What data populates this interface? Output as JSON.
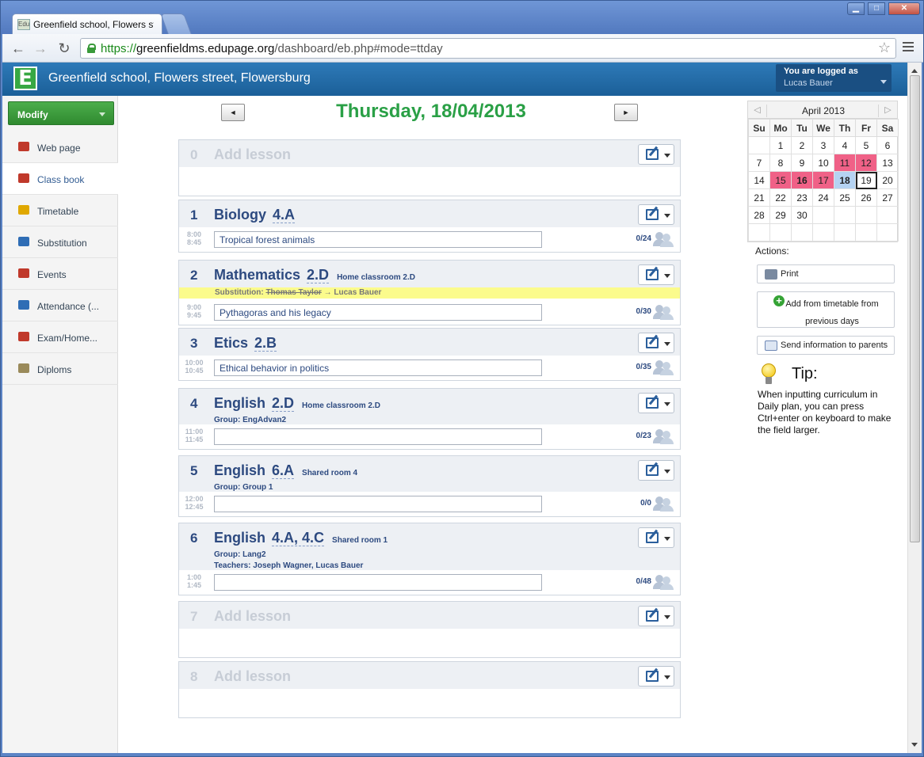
{
  "browser": {
    "tab_title": "Greenfield school, Flowers st",
    "tab_favicon": "Edu",
    "url_scheme": "https://",
    "url_host": "greenfieldms.edupage.org",
    "url_path": "/dashboard/eb.php#mode=ttday",
    "window_buttons": {
      "minimize": "▁",
      "maximize": "□",
      "close": "✕"
    }
  },
  "header": {
    "logo_letter": "E",
    "school_name": "Greenfield school, Flowers street, Flowersburg",
    "logged_label": "You are logged as",
    "user_name": "Lucas Bauer"
  },
  "sidebar": {
    "modify_label": "Modify",
    "items": [
      {
        "label": "Web page",
        "icon": "house-icon",
        "color": "#c0392b"
      },
      {
        "label": "Class book",
        "icon": "book-icon",
        "color": "#c0392b"
      },
      {
        "label": "Timetable",
        "icon": "bell-icon",
        "color": "#e0a800"
      },
      {
        "label": "Substitution",
        "icon": "people-icon",
        "color": "#2f6db5"
      },
      {
        "label": "Events",
        "icon": "calendar-icon",
        "color": "#c0392b"
      },
      {
        "label": "Attendance (...",
        "icon": "pencil-icon",
        "color": "#2f6db5"
      },
      {
        "label": "Exam/Home...",
        "icon": "books-icon",
        "color": "#c0392b"
      },
      {
        "label": "Diploms",
        "icon": "diploma-icon",
        "color": "#9a8a5a"
      }
    ]
  },
  "main": {
    "prev_label": "◄",
    "next_label": "►",
    "date_title": "Thursday, 18/04/2013",
    "lessons": [
      {
        "num": "0",
        "subject": "Add lesson",
        "empty": true
      },
      {
        "num": "1",
        "subject": "Biology",
        "class": "4.A",
        "time_start": "8:00",
        "time_end": "8:45",
        "topic": "Tropical forest animals",
        "attendance": "0/24"
      },
      {
        "num": "2",
        "subject": "Mathematics",
        "class": "2.D",
        "room": "Home classroom 2.D",
        "substitution_label": "Substitution:",
        "substitution_from": "Thomas Taylor",
        "substitution_to": "→ Lucas Bauer",
        "time_start": "9:00",
        "time_end": "9:45",
        "topic": "Pythagoras and his legacy",
        "attendance": "0/30"
      },
      {
        "num": "3",
        "subject": "Etics",
        "class": "2.B",
        "time_start": "10:00",
        "time_end": "10:45",
        "topic": "Ethical behavior in politics",
        "attendance": "0/35"
      },
      {
        "num": "4",
        "subject": "English",
        "class": "2.D",
        "room": "Home classroom 2.D",
        "group": "Group: EngAdvan2",
        "time_start": "11:00",
        "time_end": "11:45",
        "topic": "",
        "attendance": "0/23"
      },
      {
        "num": "5",
        "subject": "English",
        "class": "6.A",
        "room": "Shared room 4",
        "group": "Group: Group 1",
        "time_start": "12:00",
        "time_end": "12:45",
        "topic": "",
        "attendance": "0/0"
      },
      {
        "num": "6",
        "subject": "English",
        "class": "4.A, 4.C",
        "room": "Shared room 1",
        "group": "Group: Lang2",
        "teachers": "Teachers: Joseph Wagner, Lucas Bauer",
        "time_start": "1:00",
        "time_end": "1:45",
        "topic": "",
        "attendance": "0/48"
      },
      {
        "num": "7",
        "subject": "Add lesson",
        "empty": true
      },
      {
        "num": "8",
        "subject": "Add lesson",
        "empty": true
      }
    ]
  },
  "calendar": {
    "month": "April 2013",
    "prev": "◁",
    "next": "▷",
    "weekdays": [
      "Su",
      "Mo",
      "Tu",
      "We",
      "Th",
      "Fr",
      "Sa"
    ],
    "weeks": [
      [
        "",
        "1",
        "2",
        "3",
        "4",
        "5",
        "6"
      ],
      [
        "7",
        "8",
        "9",
        "10",
        "11",
        "12",
        "13"
      ],
      [
        "14",
        "15",
        "16",
        "17",
        "18",
        "19",
        "20"
      ],
      [
        "21",
        "22",
        "23",
        "24",
        "25",
        "26",
        "27"
      ],
      [
        "28",
        "29",
        "30",
        "",
        "",
        "",
        ""
      ],
      [
        "",
        "",
        "",
        "",
        "",
        "",
        ""
      ]
    ],
    "highlight_days": [
      "11",
      "12",
      "15",
      "16",
      "17"
    ],
    "bold_days": [
      "16"
    ],
    "selected_day": "18",
    "today": "19",
    "highlight_color": "#f06187",
    "selected_color": "#b5d3f2"
  },
  "actions": {
    "label": "Actions:",
    "print": "Print",
    "add_from_timetable": "Add from timetable from previous days",
    "send_info": "Send information to parents"
  },
  "tip": {
    "title": "Tip:",
    "text": "When inputting curriculum in Daily plan, you can press Ctrl+enter on keyboard to make the field larger."
  }
}
